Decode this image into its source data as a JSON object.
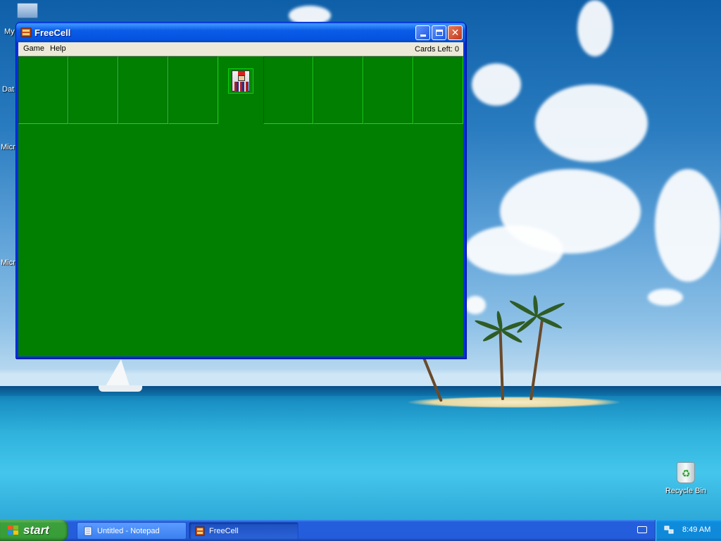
{
  "desktop": {
    "icons": [
      {
        "label": "My",
        "name": "my-computer"
      },
      {
        "label": "Dat",
        "name": "data"
      },
      {
        "label": "Micr",
        "name": "microsoft-1"
      },
      {
        "label": "Micr",
        "name": "microsoft-2"
      }
    ],
    "recycle_bin": {
      "label": "Recycle Bin",
      "icon": "recycle-bin-icon"
    }
  },
  "window": {
    "title": "FreeCell",
    "icon": "freecell-icon",
    "menu": {
      "game": "Game",
      "help": "Help"
    },
    "status": "Cards Left: 0",
    "colors": {
      "felt": "#007f00",
      "titlebar": "#0a5ce8"
    }
  },
  "taskbar": {
    "start_label": "start",
    "tasks": [
      {
        "label": "Untitled - Notepad",
        "icon": "notepad-icon"
      },
      {
        "label": "FreeCell",
        "icon": "freecell-icon"
      }
    ],
    "clock": "8:49 AM"
  }
}
